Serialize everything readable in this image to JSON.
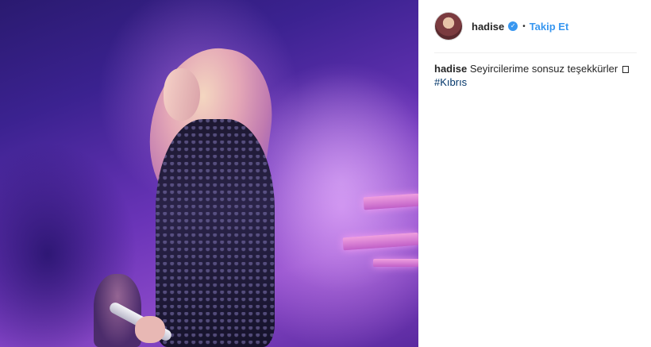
{
  "post": {
    "username": "hadise",
    "verified_icon": "verified-badge-icon",
    "separator": "•",
    "follow_label": "Takip Et",
    "caption_user": "hadise",
    "caption_text": "Seyircilerime sonsuz teşekkürler",
    "caption_emoji_placeholder": "□",
    "hashtag": "#Kıbrıs"
  },
  "colors": {
    "accent": "#3897f0",
    "hashtag": "#003569",
    "text": "#262626"
  }
}
